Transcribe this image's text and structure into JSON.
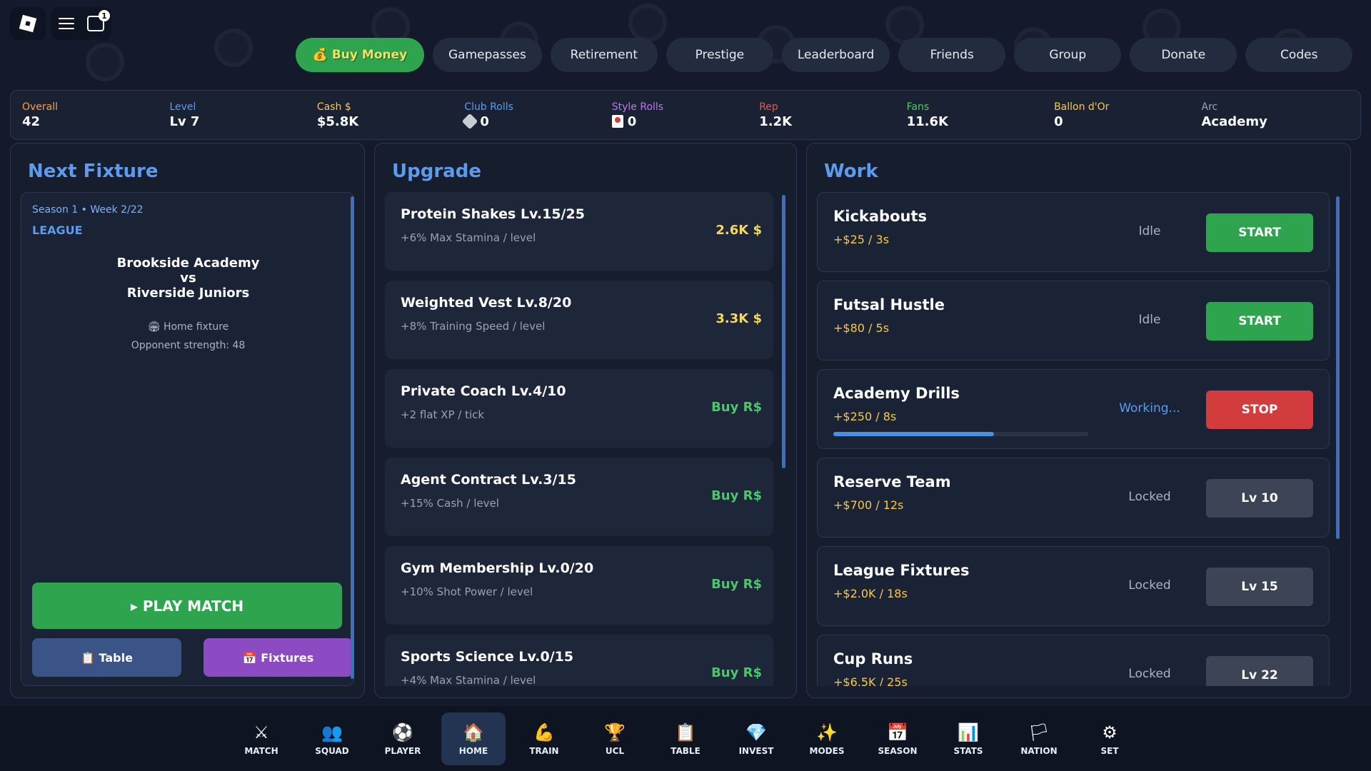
{
  "window": {
    "notification_count": "1"
  },
  "topnav": [
    {
      "label": "💰 Buy Money",
      "primary": true
    },
    {
      "label": "Gamepasses"
    },
    {
      "label": "Retirement"
    },
    {
      "label": "Prestige"
    },
    {
      "label": "Leaderboard"
    },
    {
      "label": "Friends"
    },
    {
      "label": "Group"
    },
    {
      "label": "Donate"
    },
    {
      "label": "Codes"
    }
  ],
  "stats": [
    {
      "label": "Overall",
      "value": "42",
      "color": "#f6a04d"
    },
    {
      "label": "Level",
      "value": "Lv 7",
      "color": "#5b9cf0"
    },
    {
      "label": "Cash $",
      "value": "$5.8K",
      "color": "#f6c84c"
    },
    {
      "label": "Club Rolls",
      "value": "0",
      "color": "#5b9cf0",
      "icon": "dice-icon"
    },
    {
      "label": "Style Rolls",
      "value": "0",
      "color": "#b57be8",
      "icon": "card-icon"
    },
    {
      "label": "Rep",
      "value": "1.2K",
      "color": "#e8584c"
    },
    {
      "label": "Fans",
      "value": "11.6K",
      "color": "#4cc76a"
    },
    {
      "label": "Ballon d'Or",
      "value": "0",
      "color": "#f6c84c"
    },
    {
      "label": "Arc",
      "value": "Academy",
      "color": "#9aa3b5"
    }
  ],
  "fixture": {
    "title": "Next Fixture",
    "meta": "Season 1 • Week 2/22",
    "competition": "LEAGUE",
    "home": "Brookside Academy",
    "vs": "vs",
    "away": "Riverside Juniors",
    "venue": "🏟 Home fixture",
    "opponent": "Opponent strength: 48",
    "play_label": "▸ PLAY MATCH",
    "table_label": "📋 Table",
    "fixtures_label": "📅 Fixtures"
  },
  "upgrade": {
    "title": "Upgrade",
    "items": [
      {
        "name": "Protein Shakes Lv.15/25",
        "desc": "+6% Max Stamina / level",
        "price": "2.6K $",
        "kind": "cash"
      },
      {
        "name": "Weighted Vest Lv.8/20",
        "desc": "+8% Training Speed / level",
        "price": "3.3K $",
        "kind": "cash"
      },
      {
        "name": "Private Coach Lv.4/10",
        "desc": "+2 flat XP / tick",
        "price": "Buy R$",
        "kind": "robux"
      },
      {
        "name": "Agent Contract Lv.3/15",
        "desc": "+15% Cash / level",
        "price": "Buy R$",
        "kind": "robux"
      },
      {
        "name": "Gym Membership Lv.0/20",
        "desc": "+10% Shot Power / level",
        "price": "Buy R$",
        "kind": "robux"
      },
      {
        "name": "Sports Science Lv.0/15",
        "desc": "+4% Max Stamina / level",
        "price": "Buy R$",
        "kind": "robux"
      }
    ]
  },
  "work": {
    "title": "Work",
    "items": [
      {
        "name": "Kickabouts",
        "rate": "+$25 / 3s",
        "state": "Idle",
        "action": "START",
        "kind": "start"
      },
      {
        "name": "Futsal Hustle",
        "rate": "+$80 / 5s",
        "state": "Idle",
        "action": "START",
        "kind": "start"
      },
      {
        "name": "Academy Drills",
        "rate": "+$250 / 8s",
        "state": "Working...",
        "action": "STOP",
        "kind": "stop",
        "progress": 0.63
      },
      {
        "name": "Reserve Team",
        "rate": "+$700 / 12s",
        "state": "Locked",
        "action": "Lv 10",
        "kind": "locked"
      },
      {
        "name": "League Fixtures",
        "rate": "+$2.0K / 18s",
        "state": "Locked",
        "action": "Lv 15",
        "kind": "locked"
      },
      {
        "name": "Cup Runs",
        "rate": "+$6.5K / 25s",
        "state": "Locked",
        "action": "Lv 22",
        "kind": "locked"
      }
    ]
  },
  "bottomnav": [
    {
      "label": "MATCH",
      "icon": "crossed-swords-icon",
      "glyph": "⚔"
    },
    {
      "label": "SQUAD",
      "icon": "squad-icon",
      "glyph": "👥"
    },
    {
      "label": "PLAYER",
      "icon": "soccer-ball-icon",
      "glyph": "⚽"
    },
    {
      "label": "HOME",
      "icon": "home-icon",
      "glyph": "🏠",
      "active": true
    },
    {
      "label": "TRAIN",
      "icon": "muscle-icon",
      "glyph": "💪"
    },
    {
      "label": "UCL",
      "icon": "trophy-icon",
      "glyph": "🏆"
    },
    {
      "label": "TABLE",
      "icon": "clipboard-icon",
      "glyph": "📋"
    },
    {
      "label": "INVEST",
      "icon": "diamond-icon",
      "glyph": "💎"
    },
    {
      "label": "MODES",
      "icon": "modes-icon",
      "glyph": "✨"
    },
    {
      "label": "SEASON",
      "icon": "calendar-icon",
      "glyph": "📅"
    },
    {
      "label": "STATS",
      "icon": "bar-chart-icon",
      "glyph": "📊"
    },
    {
      "label": "NATION",
      "icon": "flag-icon",
      "glyph": "🏳"
    },
    {
      "label": "SET",
      "icon": "gear-icon",
      "glyph": "⚙"
    }
  ]
}
